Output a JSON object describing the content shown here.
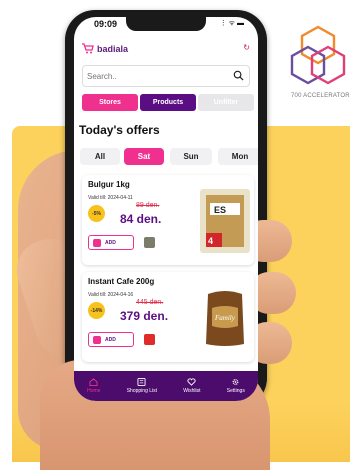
{
  "background": {
    "accent": "#fcd25c",
    "brand_caption": "700 ACCELERATOR"
  },
  "status_bar": {
    "time": "09:09",
    "icons": "⋮ ᯤ ▬"
  },
  "app": {
    "brand_name": "badiala",
    "refresh_icon": "refresh-icon",
    "search": {
      "placeholder": "Search.."
    },
    "segments": {
      "stores": "Stores",
      "products": "Products",
      "unfilter": "Unfilter"
    },
    "offers_title": "Today's offers",
    "days": [
      "All",
      "Sat",
      "Sun",
      "Mon"
    ],
    "active_day": "Sat",
    "products": [
      {
        "name": "Bulgur 1kg",
        "valid": "Valid till:  2024-04-11",
        "discount": "-5%",
        "old_price": "89 den.",
        "new_price": "84 den.",
        "add_label": "ADD"
      },
      {
        "name": "Instant Cafe 200g",
        "valid": "Valid till:  2024-04-16",
        "discount": "-14%",
        "old_price": "445 den.",
        "new_price": "379 den.",
        "add_label": "ADD"
      }
    ],
    "nav": [
      {
        "label": "Home",
        "icon": "home-icon"
      },
      {
        "label": "Shopping List",
        "icon": "list-icon"
      },
      {
        "label": "Wishlist",
        "icon": "heart-icon"
      },
      {
        "label": "Settings",
        "icon": "gear-icon"
      }
    ],
    "colors": {
      "pink": "#f0308e",
      "purple": "#5b0e84",
      "nav": "#4b0c6c"
    }
  }
}
